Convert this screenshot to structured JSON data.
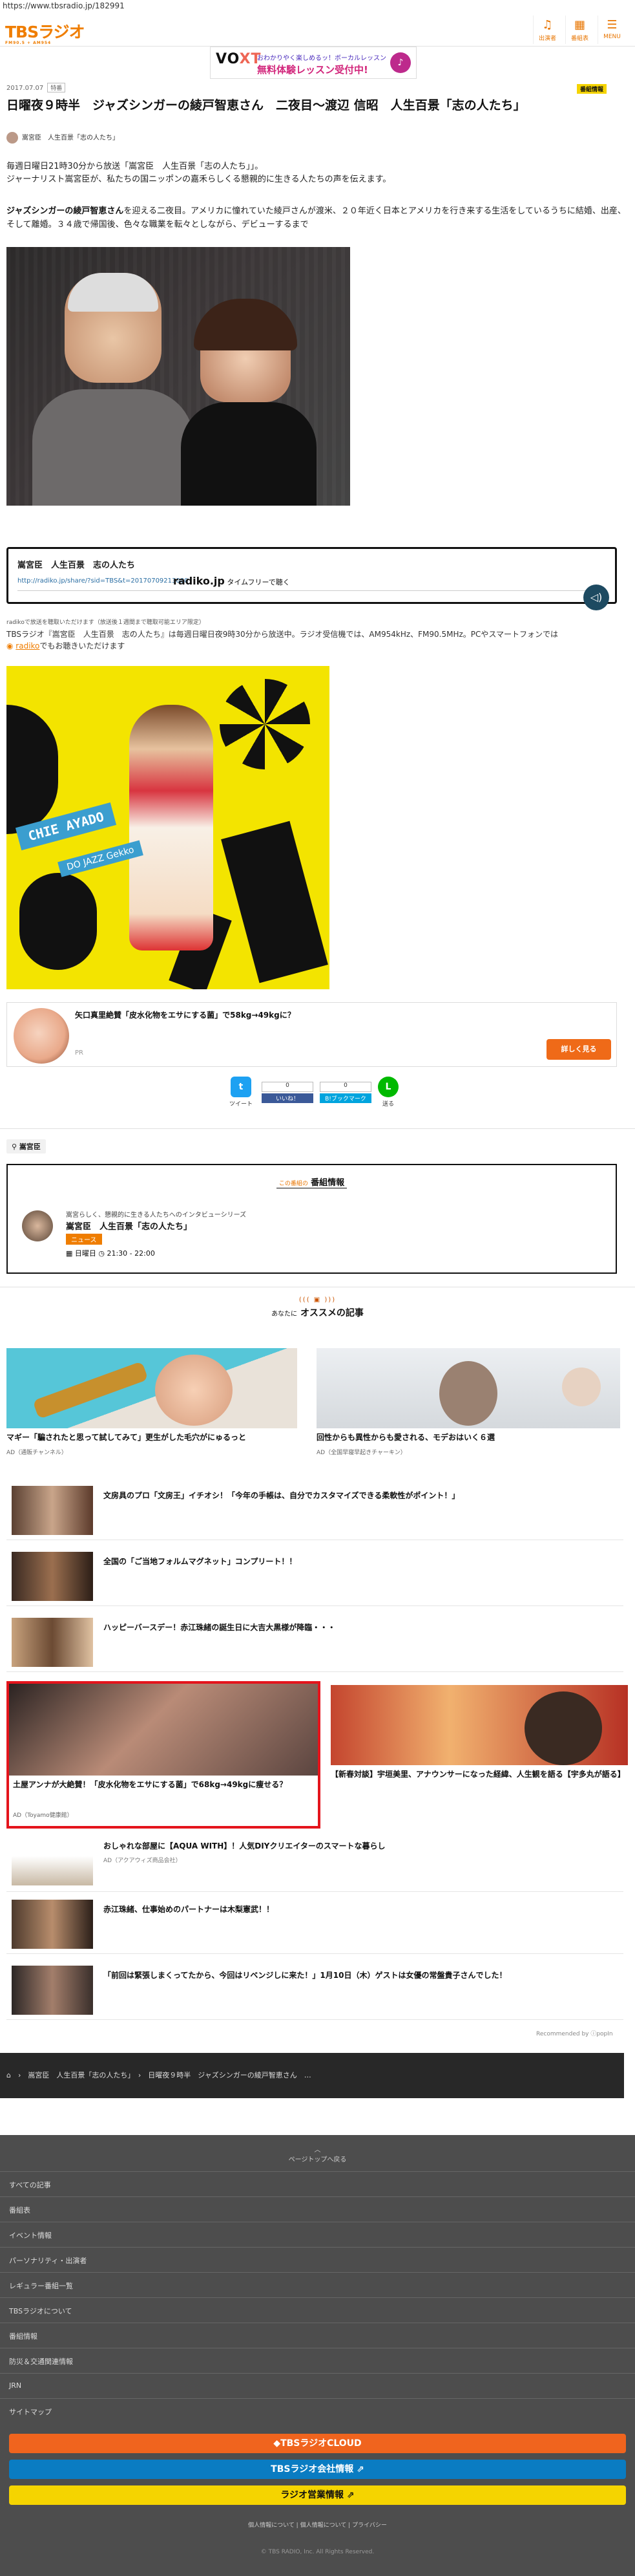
{
  "browser": {
    "url": "https://www.tbsradio.jp/182991"
  },
  "header": {
    "logo": "TBSラジオ",
    "logo_sub": "FM90.5 + AM954",
    "nav": [
      {
        "label": "出演者",
        "icon": "mic-icon"
      },
      {
        "label": "番組表",
        "icon": "schedule-icon"
      },
      {
        "label": "MENU",
        "icon": "menu-icon"
      }
    ]
  },
  "banner": {
    "brand": "VO",
    "brand2": "XT",
    "line1": "おわかりやく楽しめるッ！ボーカルレッスン",
    "line2": "無料体験レッスン受付中!",
    "cta": "♪"
  },
  "article": {
    "date": "2017.07.07",
    "tag": "特番",
    "category": "番組情報",
    "title": "日曜夜９時半　ジャズシンガーの綾戸智恵さん　二夜目〜渡辺 信昭　人生百景「志の人たち」",
    "author_show": "嵩宮臣",
    "author_title": "人生百景「志の人たち」",
    "lead": "毎週日曜日21時30分から放送「嵩宮臣　人生百景「志の人たち」」。\nジャーナリスト嵩宮臣が、私たちの国ニッポンの嘉禾らしくる懇親的に生きる人たちの声を伝えます。",
    "p2_bold": "ジャズシンガーの綾戸智恵さん",
    "p2": "を迎える二夜目。アメリカに憧れていた綾戸さんが渡米、２０年近く日本とアメリカを行き来する生活をしているうちに結婚、出産、そして離婚。３４歳で帰国後、色々な職業を転々としながら、デビューするまで"
  },
  "radiko": {
    "title": "嵩宮臣　人生百景　志の人たち",
    "url": "http://radiko.jp/share/?sid=TBS&t=20170709213000",
    "brand": "radiko.jp",
    "link": "タイムフリーで聴く",
    "play": "◁)"
  },
  "note": {
    "small": "radikoで放送を聴取いただけます（放送後１週間まで聴取可能エリア限定）",
    "line": "TBSラジオ『嵩宮臣　人生百景　志の人たち』は毎週日曜日夜9時30分から放送中。ラジオ受信機では、AM954kHz、FM90.5MHz。PCやスマートフォンでは",
    "radiko": "radiko",
    "tail": "でもお聴きいただけます"
  },
  "album": {
    "name": "CHIE AYADO",
    "sub": "DO JAZZ Gekko"
  },
  "ad": {
    "text": "矢口真里絶賛「皮水化物をエサにする菌」で58kg→49kgに？",
    "pr": "PR",
    "button": "詳しく見る"
  },
  "share": {
    "tweet_label": "ツイート",
    "like_count": "0",
    "like_label": "いいね！",
    "hatena_count": "0",
    "hatena_label": "B!ブックマーク",
    "line_label": "送る"
  },
  "tag_search": "嵩宮臣",
  "program": {
    "heading": "この番組の",
    "heading2": "番組情報",
    "subtitle": "嵩宮らしく、懇親的に生きる人たちへのインタビューシリーズ",
    "name": "嵩宮臣　人生百景「志の人たち」",
    "badge": "ニュース",
    "time": "日曜日 ◷ 21:30 - 22:00"
  },
  "recommend": {
    "top": "あなたに",
    "title": "オススメの記事",
    "cards": [
      {
        "title": "マギー「騙されたと思って試してみて」更生がした毛穴がにゅるっと",
        "ad": "AD（通販チャンネル）"
      },
      {
        "title": "回性からも異性からも愛される、モデおはいく６選",
        "ad": "AD（全国早寝早起きチャーキン）"
      }
    ],
    "rows": [
      {
        "title": "文房具のプロ「文房王」イチオシ！「今年の手帳は、自分でカスタマイズできる柔軟性がポイント！」",
        "ad": ""
      },
      {
        "title": "全国の「ご当地フォルムマグネット」コンプリート！！",
        "ad": ""
      },
      {
        "title": "ハッピーバースデー！赤江珠緒の誕生日に大吉大黒様が降臨・・・",
        "ad": ""
      }
    ],
    "highlight": {
      "title": "土屋アンナが大絶賛！「皮水化物をエサにする菌」で68kg→49kgに痩せる？",
      "ad": "AD（Toyamo健康館）"
    },
    "highlight2": {
      "title": "【新春対談】宇垣美里、アナウンサーになった経緯、人生観を語る【宇多丸が語る】",
      "ad": ""
    },
    "rows2": [
      {
        "title": "おしゃれな部屋に【AQUA WITH】！人気DIYクリエイターのスマートな暮らし",
        "ad": "AD（アクアウィズ商品会社）"
      },
      {
        "title": "赤江珠緒、仕事始めのパートナーは木梨憲武！！",
        "ad": ""
      },
      {
        "title": "「前回は緊張しまくってたから、今回はリベンジしに来た！」1月10日（木）ゲストは女優の常盤貴子さんでした！",
        "ad": ""
      }
    ],
    "by": "Recommended by ⓘpopIn"
  },
  "breadcrumb": {
    "home": "⌂",
    "b1": "嵩宮臣　人生百景「志の人たち」",
    "b2": "日曜夜９時半　ジャズシンガーの綾戸智恵さん　…"
  },
  "footer": {
    "pagetop": "ページトップへ戻る",
    "links": [
      "すべての記事",
      "番組表",
      "イベント情報",
      "パーソナリティ・出演者",
      "レギュラー番組一覧",
      "TBSラジオについて",
      "番組情報",
      "防災＆交通関連情報",
      "JRN",
      "サイトマップ"
    ],
    "btn1": "◆TBSラジオCLOUD",
    "btn2": "TBSラジオ会社情報 ⇗",
    "btn3": "ラジオ営業情報 ⇗",
    "small_links": "個人情報について | 個人情報について | プライバシー",
    "copyright": "© TBS RADIO, Inc. All Rights Reserved."
  },
  "colors": {
    "accent": "#ef7d00",
    "footer_bg": "#4d4d4d",
    "highlight": "#e4141c",
    "cloud_btn": "#f0641e",
    "corp_btn": "#0a7cc2",
    "sales_btn": "#f5d400"
  }
}
